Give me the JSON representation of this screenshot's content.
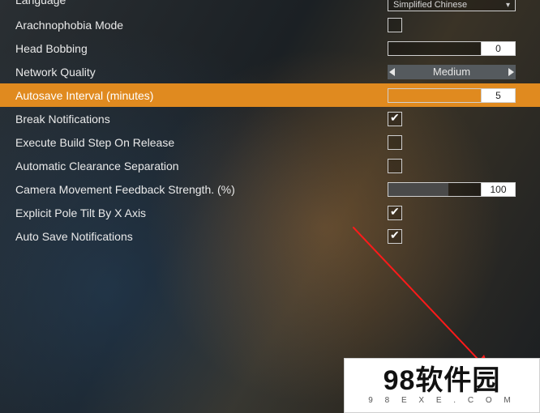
{
  "colors": {
    "accent": "#e08a1f"
  },
  "settings": [
    {
      "key": "language",
      "label": "Language",
      "type": "dropdown",
      "value": "Simplified Chinese"
    },
    {
      "key": "arachnophobia",
      "label": "Arachnophobia Mode",
      "type": "checkbox",
      "checked": false
    },
    {
      "key": "head_bobbing",
      "label": "Head Bobbing",
      "type": "slider",
      "value": "0",
      "fill_pct": 0
    },
    {
      "key": "network_quality",
      "label": "Network Quality",
      "type": "arrows",
      "value": "Medium"
    },
    {
      "key": "autosave_interval",
      "label": "Autosave Interval (minutes)",
      "type": "slider",
      "value": "5",
      "fill_pct": 2,
      "highlight": true
    },
    {
      "key": "break_notifications",
      "label": "Break Notifications",
      "type": "checkbox",
      "checked": true
    },
    {
      "key": "execute_build_on_release",
      "label": "Execute Build Step On Release",
      "type": "checkbox",
      "checked": false
    },
    {
      "key": "auto_clearance_separation",
      "label": "Automatic Clearance Separation",
      "type": "checkbox",
      "checked": false
    },
    {
      "key": "camera_feedback_strength",
      "label": "Camera Movement Feedback Strength. (%)",
      "type": "slider",
      "value": "100",
      "fill_pct": 50
    },
    {
      "key": "explicit_pole_tilt_x",
      "label": "Explicit Pole Tilt By X Axis",
      "type": "checkbox",
      "checked": true
    },
    {
      "key": "auto_save_notifications",
      "label": "Auto Save Notifications",
      "type": "checkbox",
      "checked": true
    }
  ],
  "watermark": {
    "text": "98软件园",
    "url": "9 8 E X E . C O M"
  }
}
